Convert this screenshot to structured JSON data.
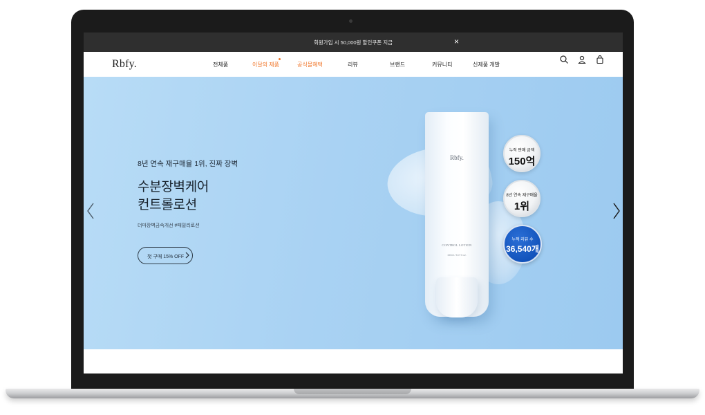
{
  "banner": {
    "text": "회원가입 시 50,000원 할인쿠폰 지급",
    "close_label": "×"
  },
  "nav": {
    "logo": "Rbfy.",
    "menu": [
      {
        "label": "전체품"
      },
      {
        "label": "이달의 제품",
        "accent": true
      },
      {
        "label": "공식몰혜택",
        "accent": true
      },
      {
        "label": "리뷰"
      },
      {
        "label": "브랜드"
      },
      {
        "label": "커뮤니티"
      },
      {
        "label": "신제품 개발"
      }
    ],
    "icons": [
      "search-icon",
      "user-icon",
      "shopping-bag-icon"
    ]
  },
  "hero": {
    "subtitle": "8년 연속 재구매율 1위, 진짜 장벽",
    "title_line1": "수분장벽케어",
    "title_line2": "컨트롤로션",
    "tags": "더마장벽금속개선 #패밀리로션",
    "cta_label": "첫 구매 15% OFF",
    "product": {
      "brand": "Rbfy.",
      "name": "CONTROL LOTION",
      "volume": "150ml / 5.07 fl.oz."
    },
    "badges": [
      {
        "small": "누적 판매 금액",
        "big": "150억",
        "style": "silver"
      },
      {
        "small": "8년 연속 재구매율",
        "big": "1위",
        "style": "silver"
      },
      {
        "small": "누적 리뷰 수",
        "big": "36,540개",
        "style": "blue"
      }
    ]
  },
  "colors": {
    "accent": "#f0762a",
    "hero_bg": "#a9d2f3",
    "banner_bg": "#2f2f2f",
    "badge_blue": "#0f4fb8"
  }
}
